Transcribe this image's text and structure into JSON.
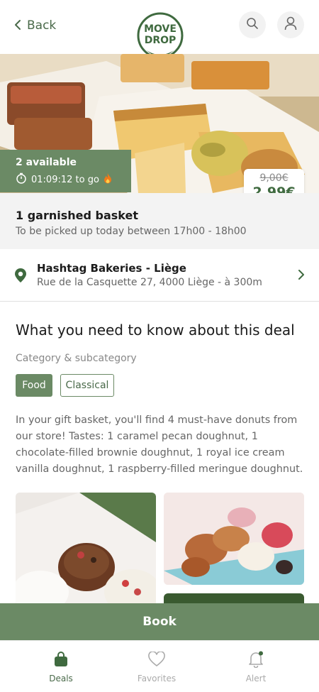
{
  "header": {
    "back_label": "Back",
    "logo_text_line1": "MOVE",
    "logo_text_line2": "DROP"
  },
  "offer": {
    "available": "2 available",
    "timer": "01:09:12 to go",
    "old_price": "9,00€",
    "new_price": "2,99€",
    "title": "1 garnished basket",
    "pickup": "To be picked up today between 17h00 - 18h00"
  },
  "store": {
    "name": "Hashtag Bakeries - Liège",
    "address": "Rue de la Casquette 27, 4000 Liège - à 300m"
  },
  "details": {
    "section_title": "What you need to know about this deal",
    "category_label": "Category & subcategory",
    "tags": [
      "Food",
      "Classical"
    ],
    "description": "In your gift basket, you'll find 4 must-have donuts from our store! Tastes: 1 caramel pecan doughnut, 1 chocolate-filled brownie doughnut, 1 royal ice cream vanilla doughnut, 1 raspberry-filled meringue doughnut."
  },
  "book_label": "Book",
  "nav": {
    "items": [
      {
        "label": "Deals",
        "icon": "bag-icon",
        "active": true
      },
      {
        "label": "Favorites",
        "icon": "heart-icon",
        "active": false
      },
      {
        "label": "Alert",
        "icon": "bell-icon",
        "active": false
      }
    ]
  },
  "colors": {
    "brand": "#6b8a65",
    "brand_dark": "#3f6a3f"
  }
}
